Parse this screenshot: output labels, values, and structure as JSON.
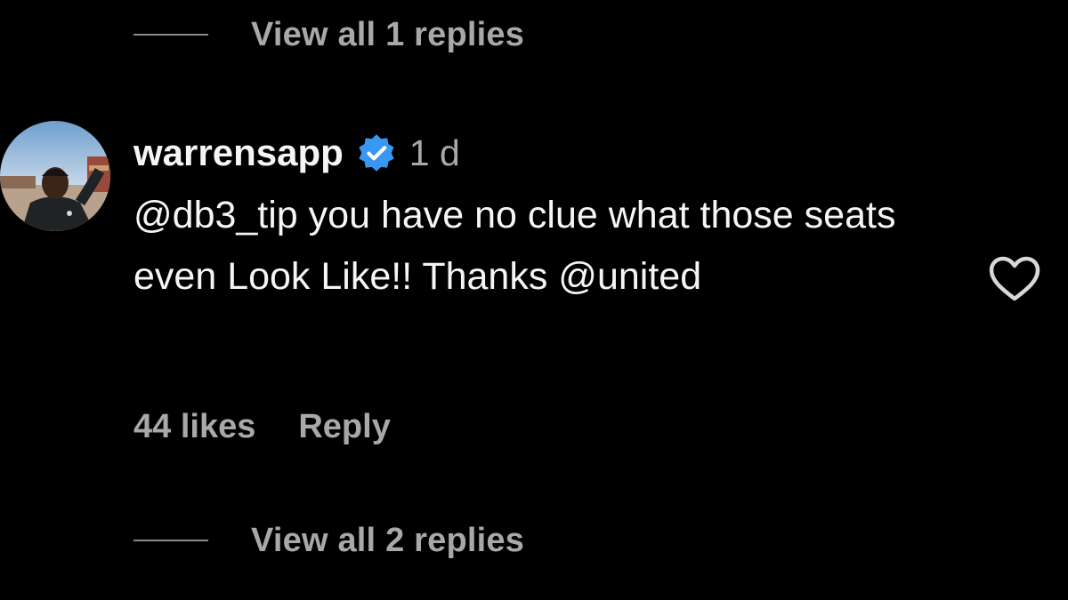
{
  "thread_top": {
    "view_replies_label": "View all 1 replies"
  },
  "comment": {
    "username": "warrensapp",
    "verified": true,
    "timestamp": "1 d",
    "text_segments": [
      {
        "kind": "mention",
        "text": "@db3_tip"
      },
      {
        "kind": "text",
        "text": " you have no clue what those seats even Look Like!! Thanks "
      },
      {
        "kind": "mention",
        "text": "@united"
      }
    ],
    "likes_label": "44 likes",
    "reply_label": "Reply",
    "liked": false
  },
  "thread_bottom": {
    "view_replies_label": "View all 2 replies"
  },
  "colors": {
    "background": "#000000",
    "primary_text": "#f5f5f5",
    "secondary_text": "#a8a8a8",
    "verified_badge": "#3897f0"
  },
  "icons": {
    "verified": "verified-badge-icon",
    "like": "heart-outline-icon",
    "avatar": "user-avatar-photo"
  }
}
